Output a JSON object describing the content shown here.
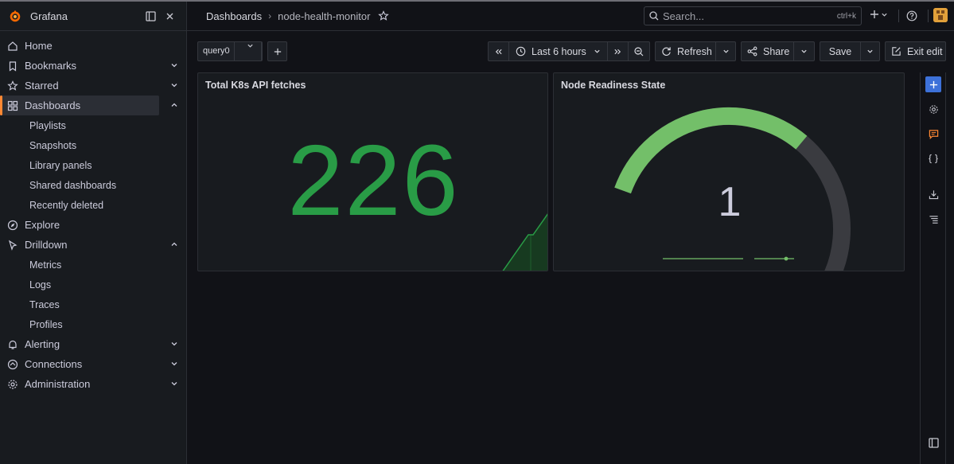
{
  "app": {
    "brand": "Grafana"
  },
  "nav": {
    "home": "Home",
    "bookmarks": "Bookmarks",
    "starred": "Starred",
    "dashboards": "Dashboards",
    "dashboards_sub": [
      "Playlists",
      "Snapshots",
      "Library panels",
      "Shared dashboards",
      "Recently deleted"
    ],
    "explore": "Explore",
    "drilldown": "Drilldown",
    "drilldown_sub": [
      "Metrics",
      "Logs",
      "Traces",
      "Profiles"
    ],
    "alerting": "Alerting",
    "connections": "Connections",
    "administration": "Administration"
  },
  "breadcrumb": {
    "root": "Dashboards",
    "current": "node-health-monitor"
  },
  "search": {
    "placeholder": "Search...",
    "shortcut": "ctrl+k"
  },
  "toolbar": {
    "variable": "query0",
    "time_range": "Last 6 hours",
    "refresh": "Refresh",
    "share": "Share",
    "save": "Save",
    "exit_edit": "Exit edit"
  },
  "panels": {
    "stat": {
      "title": "Total K8s API fetches",
      "value": "226",
      "color": "#299c46"
    },
    "gauge": {
      "title": "Node Readiness State",
      "value": "1",
      "fill_fraction": 0.5,
      "color": "#73bf69"
    }
  },
  "colors": {
    "accent": "#ff8833",
    "primary": "#3d71d9"
  }
}
